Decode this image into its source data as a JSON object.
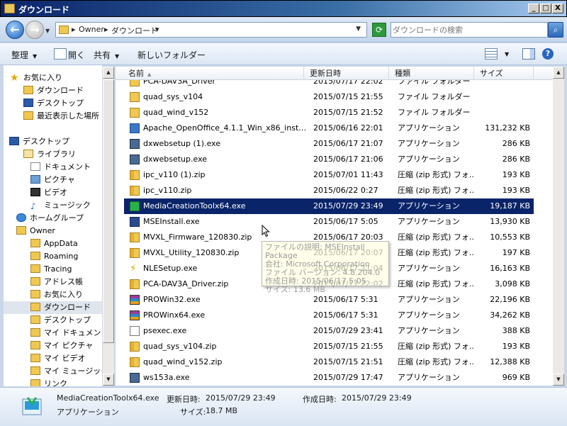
{
  "window": {
    "title": "ダウンロード",
    "btn_min": "_",
    "btn_max": "□",
    "btn_close": "X"
  },
  "address": {
    "crumbs": [
      "Owner",
      "ダウンロード"
    ],
    "search_placeholder": "ダウンロードの検索"
  },
  "toolbar": {
    "organize": "整理",
    "open": "開く",
    "share": "共有",
    "new_folder": "新しいフォルダー"
  },
  "nav": {
    "items": [
      {
        "label": "お気に入り",
        "icon": "star-icon"
      },
      {
        "label": "ダウンロード",
        "icon": "folder-icon"
      },
      {
        "label": "デスクトップ",
        "icon": "desktop-icon"
      },
      {
        "label": "最近表示した場所",
        "icon": "folder-icon"
      },
      {
        "label": "デスクトップ",
        "icon": "desktop-icon"
      },
      {
        "label": "ライブラリ",
        "icon": "library-icon"
      },
      {
        "label": "ドキュメント",
        "icon": "document-icon"
      },
      {
        "label": "ピクチャ",
        "icon": "picture-icon"
      },
      {
        "label": "ビデオ",
        "icon": "video-icon"
      },
      {
        "label": "ミュージック",
        "icon": "music-icon"
      },
      {
        "label": "ホームグループ",
        "icon": "homegroup-icon"
      },
      {
        "label": "Owner",
        "icon": "user-folder-icon"
      },
      {
        "label": "AppData",
        "icon": "folder-icon"
      },
      {
        "label": "Roaming",
        "icon": "folder-icon"
      },
      {
        "label": "Tracing",
        "icon": "folder-icon"
      },
      {
        "label": "アドレス帳",
        "icon": "folder-icon"
      },
      {
        "label": "お気に入り",
        "icon": "folder-icon"
      },
      {
        "label": "ダウンロード",
        "icon": "folder-icon"
      },
      {
        "label": "デスクトップ",
        "icon": "folder-icon"
      },
      {
        "label": "マイ ドキュメント",
        "icon": "folder-icon"
      },
      {
        "label": "マイ ピクチャ",
        "icon": "folder-icon"
      },
      {
        "label": "マイ ビデオ",
        "icon": "folder-icon"
      },
      {
        "label": "マイ ミュージック",
        "icon": "folder-icon"
      },
      {
        "label": "リンク",
        "icon": "folder-icon"
      }
    ]
  },
  "columns": {
    "name": "名前",
    "date": "更新日時",
    "type": "種類",
    "size": "サイズ"
  },
  "files": [
    {
      "name": "PCA-DAV3A_Driver",
      "date": "2015/07/17 22:02",
      "type": "ファイル フォルダー",
      "size": "",
      "icon": "folder-icon"
    },
    {
      "name": "quad_sys_v104",
      "date": "2015/07/15 21:55",
      "type": "ファイル フォルダー",
      "size": "",
      "icon": "folder-icon"
    },
    {
      "name": "quad_wind_v152",
      "date": "2015/07/15 21:52",
      "type": "ファイル フォルダー",
      "size": "",
      "icon": "folder-icon"
    },
    {
      "name": "Apache_OpenOffice_4.1.1_Win_x86_install_ja...",
      "date": "2015/06/16 22:01",
      "type": "アプリケーション",
      "size": "131,232 KB",
      "icon": "openoffice-icon"
    },
    {
      "name": "dxwebsetup (1).exe",
      "date": "2015/06/17 21:07",
      "type": "アプリケーション",
      "size": "286 KB",
      "icon": "setup-icon"
    },
    {
      "name": "dxwebsetup.exe",
      "date": "2015/06/17 21:06",
      "type": "アプリケーション",
      "size": "286 KB",
      "icon": "setup-icon"
    },
    {
      "name": "ipc_v110 (1).zip",
      "date": "2015/07/01 11:43",
      "type": "圧縮 (zip 形式) フォ...",
      "size": "193 KB",
      "icon": "zip-icon"
    },
    {
      "name": "ipc_v110.zip",
      "date": "2015/06/22 0:27",
      "type": "圧縮 (zip 形式) フォ...",
      "size": "193 KB",
      "icon": "zip-icon"
    },
    {
      "name": "MediaCreationToolx64.exe",
      "date": "2015/07/29 23:49",
      "type": "アプリケーション",
      "size": "19,187 KB",
      "icon": "windows-setup-icon"
    },
    {
      "name": "MSEInstall.exe",
      "date": "2015/06/17 5:05",
      "type": "アプリケーション",
      "size": "13,930 KB",
      "icon": "shield-icon"
    },
    {
      "name": "MVXL_Firmware_120830.zip",
      "date": "2015/06/17 20:03",
      "type": "圧縮 (zip 形式) フォ...",
      "size": "10,553 KB",
      "icon": "zip-icon"
    },
    {
      "name": "MVXL_Utility_120830.zip",
      "date": "2015/06/17 20:07",
      "type": "圧縮 (zip 形式) フォ...",
      "size": "197 KB",
      "icon": "zip-icon"
    },
    {
      "name": "NLESetup.exe",
      "date": "2015/06/17 21:04",
      "type": "アプリケーション",
      "size": "16,163 KB",
      "icon": "lightning-icon"
    },
    {
      "name": "PCA-DAV3A_Driver.zip",
      "date": "2015/07/17 22:02",
      "type": "圧縮 (zip 形式) フォ...",
      "size": "3,098 KB",
      "icon": "zip-icon"
    },
    {
      "name": "PROWin32.exe",
      "date": "2015/06/17 5:31",
      "type": "アプリケーション",
      "size": "22,196 KB",
      "icon": "winrar-icon"
    },
    {
      "name": "PROWinx64.exe",
      "date": "2015/06/17 5:31",
      "type": "アプリケーション",
      "size": "34,262 KB",
      "icon": "winrar-icon"
    },
    {
      "name": "psexec.exe",
      "date": "2015/07/29 23:41",
      "type": "アプリケーション",
      "size": "388 KB",
      "icon": "exe-icon"
    },
    {
      "name": "quad_sys_v104.zip",
      "date": "2015/07/15 21:55",
      "type": "圧縮 (zip 形式) フォ...",
      "size": "193 KB",
      "icon": "zip-icon"
    },
    {
      "name": "quad_wind_v152.zip",
      "date": "2015/07/15 21:51",
      "type": "圧縮 (zip 形式) フォ...",
      "size": "12,388 KB",
      "icon": "zip-icon"
    },
    {
      "name": "ws153a.exe",
      "date": "2015/07/29 17:47",
      "type": "アプリケーション",
      "size": "969 KB",
      "icon": "setup-icon"
    }
  ],
  "tooltip": {
    "lines": [
      "ファイルの説明: MSEInstall Package",
      "会社: Microsoft Corporation",
      "ファイル バージョン: 4.8.204.0",
      "作成日時: 2015/06/17 5:05",
      "サイズ: 13.6 MB"
    ]
  },
  "details": {
    "name": "MediaCreationToolx64.exe",
    "type": "アプリケーション",
    "modified_label": "更新日時:",
    "modified": "2015/07/29 23:49",
    "created_label": "作成日時:",
    "created": "2015/07/29 23:49",
    "size_label": "サイズ:",
    "size": "18.7 MB"
  },
  "colors": {
    "selection": "#0a246a",
    "title_start": "#0a246a",
    "title_end": "#a6caf0"
  }
}
